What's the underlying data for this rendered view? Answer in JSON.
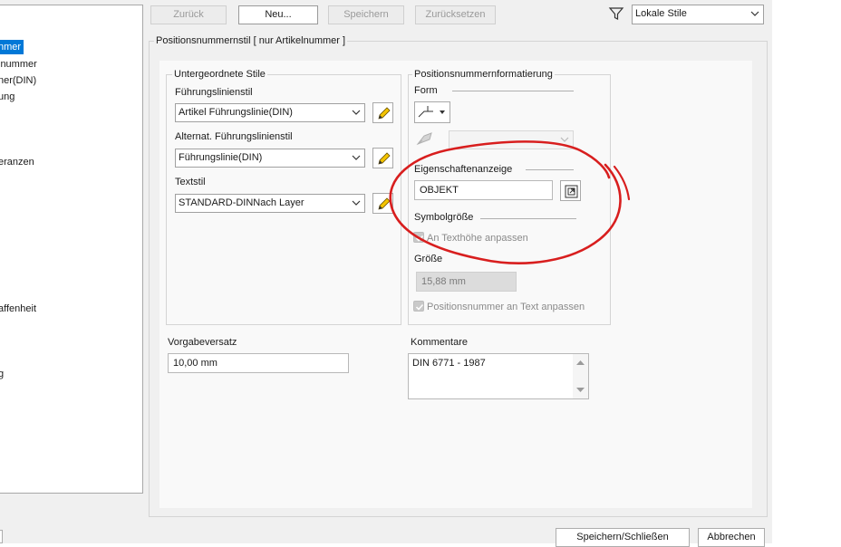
{
  "toolbar": {
    "back_label": "Zurück",
    "new_label": "Neu...",
    "save_label": "Speichern",
    "reset_label": "Zurücksetzen",
    "style_filter_value": "Lokale Stile"
  },
  "tree": {
    "items": [
      "nmer",
      "lnummer",
      "ner(DIN)",
      "ung",
      "eranzen",
      "affenheit",
      "g"
    ],
    "selected_index": 0
  },
  "main": {
    "title": "Positionsnummernstil [ nur  Artikelnummer ]",
    "sub_styles": {
      "title": "Untergeordnete Stile",
      "leader_style_label": "Führungslinienstil",
      "leader_style_value": "Artikel Führungslinie(DIN)",
      "alt_leader_style_label": "Alternat. Führungslinienstil",
      "alt_leader_style_value": "Führungslinie(DIN)",
      "text_style_label": "Textstil",
      "text_style_value": "STANDARD-DINNach Layer"
    },
    "format": {
      "title": "Positionsnummernformatierung",
      "shape_label": "Form",
      "property_display_label": "Eigenschaftenanzeige",
      "property_display_value": "OBJEKT",
      "symbol_size_label": "Symbolgröße",
      "fit_text_height_label": "An Texthöhe anpassen",
      "size_label": "Größe",
      "size_value": "15,88 mm",
      "fit_balloon_label": "Positionsnummer an Text anpassen"
    },
    "default_offset_label": "Vorgabeversatz",
    "default_offset_value": "10,00 mm",
    "comments_label": "Kommentare",
    "comments_value": "DIN 6771 - 1987"
  },
  "footer": {
    "save_close_label": "Speichern/Schließen",
    "cancel_label": "Abbrechen"
  },
  "colors": {
    "selection": "#0078d7",
    "annotation": "#d81e1e",
    "pencil_yellow": "#f4c400"
  }
}
